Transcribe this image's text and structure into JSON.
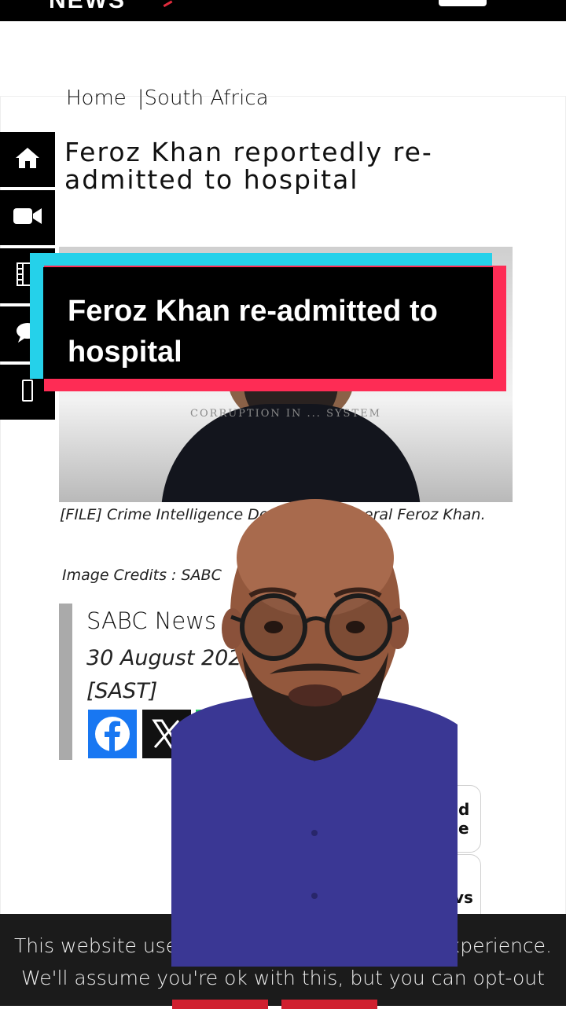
{
  "header": {
    "logo_text": "NEWS",
    "menu_icon": "menu-button"
  },
  "breadcrumb": {
    "home": "Home",
    "section": "South Africa"
  },
  "sidebar": {
    "items": [
      {
        "icon": "home-icon"
      },
      {
        "icon": "video-camera-icon"
      },
      {
        "icon": "film-icon"
      },
      {
        "icon": "chat-bubble-icon"
      },
      {
        "icon": "mobile-phone-icon"
      }
    ]
  },
  "article": {
    "headline": "Feroz Khan reportedly re-admitted to hospital",
    "image": {
      "overlay_title": "Feroz Khan re-admitted to hospital",
      "banner_text": "CORRUPTION IN ... SYSTEM"
    },
    "caption": "[FILE] Crime Intelligence De     d Major General Feroz Khan.",
    "image_credits": "Image Credits :  SABC",
    "author": "SABC News",
    "date": "30 August 202",
    "timezone": "[SAST]",
    "share": [
      "facebook-icon",
      "x-icon",
      "whatsapp-icon"
    ]
  },
  "pills": {
    "first_top": "d",
    "first_bottom": "e",
    "second": "vs"
  },
  "cookie_banner": {
    "line1_left": "This website use",
    "line1_right": "xperience.",
    "line2": "We'll assume you're ok with this, but you can opt-out"
  },
  "colors": {
    "cyan": "#25d1ea",
    "red": "#fe2c55",
    "brand_red": "#d0202f",
    "facebook": "#1877f2",
    "whatsapp": "#25d366"
  }
}
